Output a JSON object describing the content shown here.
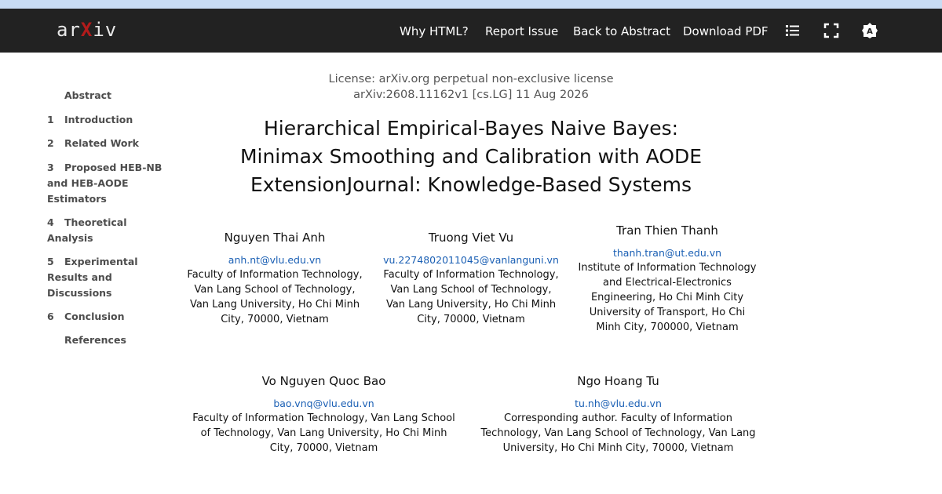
{
  "navbar": {
    "logo_text": "arXiv",
    "links": [
      "Why HTML?",
      "Report Issue",
      "Back to Abstract",
      "Download PDF"
    ],
    "icons": [
      "list-icon",
      "fullscreen-icon",
      "theme-toggle-icon"
    ]
  },
  "toc": {
    "items": [
      {
        "num": "",
        "label": "Abstract"
      },
      {
        "num": "1",
        "label": "Introduction"
      },
      {
        "num": "2",
        "label": "Related Work"
      },
      {
        "num": "3",
        "label": "Proposed HEB-NB and HEB-AODE Estimators"
      },
      {
        "num": "4",
        "label": "Theoretical Analysis"
      },
      {
        "num": "5",
        "label": "Experimental Results and Discussions"
      },
      {
        "num": "6",
        "label": "Conclusion"
      },
      {
        "num": "",
        "label": "References"
      }
    ]
  },
  "paper": {
    "license": "License: arXiv.org perpetual non-exclusive license",
    "arxiv_id": "arXiv:2608.11162v1 [cs.LG] 11 Aug 2026",
    "title_line1": "Hierarchical Empirical-Bayes Naive Bayes:",
    "title_line2": "Minimax Smoothing and Calibration with AODE",
    "title_line3": "ExtensionJournal: Knowledge-Based Systems",
    "authors": [
      {
        "name": "Nguyen Thai Anh",
        "email": "anh.nt@vlu.edu.vn",
        "affiliation": "Faculty of Information Technology, Van Lang School of Technology, Van Lang University, Ho Chi Minh City, 70000, Vietnam"
      },
      {
        "name": "Truong Viet Vu",
        "email": "vu.2274802011045@vanlanguni.vn",
        "affiliation": "Faculty of Information Technology, Van Lang School of Technology, Van Lang University, Ho Chi Minh City, 70000, Vietnam"
      },
      {
        "name": "Tran Thien Thanh",
        "email": "thanh.tran@ut.edu.vn",
        "affiliation": "Institute of Information Technology and Electrical-Electronics Engineering, Ho Chi Minh City University of Transport, Ho Chi Minh City, 700000, Vietnam"
      },
      {
        "name": "Vo Nguyen Quoc Bao",
        "email": "bao.vnq@vlu.edu.vn",
        "affiliation": "Faculty of Information Technology, Van Lang School of Technology, Van Lang University, Ho Chi Minh City, 70000, Vietnam"
      },
      {
        "name": "Ngo Hoang Tu",
        "email": "tu.nh@vlu.edu.vn",
        "affiliation": "Corresponding author. Faculty of Information Technology, Van Lang School of Technology, Van Lang University, Ho Chi Minh City, 70000, Vietnam"
      }
    ]
  },
  "colors": {
    "navbar_bg": "#222222",
    "link_blue": "#1a5fb4",
    "logo_x": "#b31b1b"
  }
}
